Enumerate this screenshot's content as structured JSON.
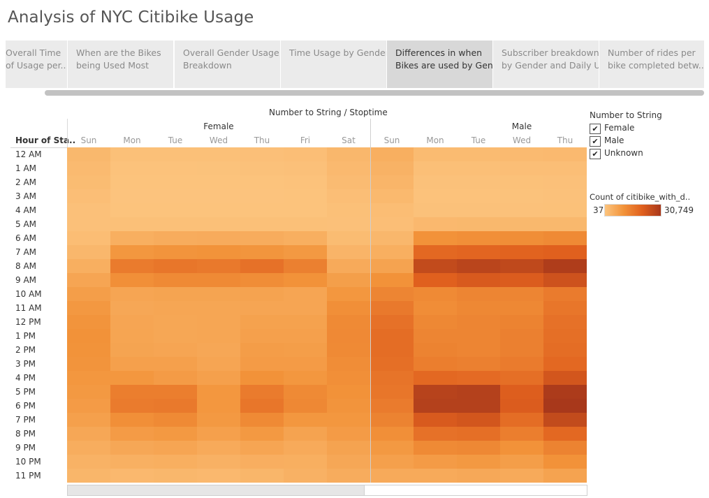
{
  "page_title": "Analysis of NYC Citibike Usage",
  "tabs": [
    {
      "label_line1": "Overall Time",
      "label_line2": "of Usage per..",
      "active": false
    },
    {
      "label_line1": "When are the Bikes",
      "label_line2": "being Used Most",
      "active": false
    },
    {
      "label_line1": "Overall Gender Usage",
      "label_line2": "Breakdown",
      "active": false
    },
    {
      "label_line1": "Time Usage by Gender",
      "label_line2": "",
      "active": false
    },
    {
      "label_line1": "Differences in when",
      "label_line2": "Bikes are used by Gen..",
      "active": true
    },
    {
      "label_line1": "Subscriber breakdown",
      "label_line2": "by Gender and Daily U..",
      "active": false
    },
    {
      "label_line1": "Number of rides per",
      "label_line2": "bike completed betw..",
      "active": false
    }
  ],
  "chart": {
    "column_axis_title": "Number to String / Stoptime",
    "row_header": "Hour of Sta..",
    "groups": [
      "Female",
      "Male"
    ]
  },
  "legend": {
    "filter_title": "Number to String",
    "filters": [
      {
        "label": "Female",
        "checked": true
      },
      {
        "label": "Male",
        "checked": true
      },
      {
        "label": "Unknown",
        "checked": true
      }
    ],
    "color_title": "Count of citibike_with_d..",
    "color_min": "37",
    "color_max": "30,749",
    "check_glyph": "✔"
  },
  "chart_data": {
    "type": "heatmap",
    "title": "",
    "xlabel": "Number to String / Stoptime",
    "ylabel": "Hour of Sta..",
    "value_label": "Count of citibike_with_d..",
    "value_range": [
      37,
      30749
    ],
    "color_scale": [
      "#fcc47e",
      "#f2933a",
      "#e0601e",
      "#a8381b"
    ],
    "hours": [
      "12 AM",
      "1 AM",
      "2 AM",
      "3 AM",
      "4 AM",
      "5 AM",
      "6 AM",
      "7 AM",
      "8 AM",
      "9 AM",
      "10 AM",
      "11 AM",
      "12 PM",
      "1 PM",
      "2 PM",
      "3 PM",
      "4 PM",
      "5 PM",
      "6 PM",
      "7 PM",
      "8 PM",
      "9 PM",
      "10 PM",
      "11 PM"
    ],
    "groups": [
      {
        "name": "Female",
        "days": [
          "Sun",
          "Mon",
          "Tue",
          "Wed",
          "Thu",
          "Fri",
          "Sat"
        ],
        "values": [
          [
            2600,
            900,
            900,
            950,
            1000,
            1300,
            2700
          ],
          [
            2200,
            500,
            500,
            550,
            600,
            800,
            2300
          ],
          [
            1800,
            300,
            300,
            320,
            350,
            500,
            1900
          ],
          [
            1200,
            200,
            200,
            220,
            240,
            300,
            1300
          ],
          [
            800,
            300,
            300,
            320,
            340,
            350,
            900
          ],
          [
            800,
            900,
            900,
            950,
            950,
            900,
            800
          ],
          [
            1500,
            4500,
            5000,
            5200,
            5000,
            4500,
            1800
          ],
          [
            2700,
            9500,
            10000,
            10200,
            9800,
            9000,
            3300
          ],
          [
            4500,
            15000,
            16000,
            15500,
            17000,
            14000,
            5500
          ],
          [
            6500,
            11000,
            12000,
            12000,
            11500,
            10500,
            7800
          ],
          [
            8000,
            6500,
            6800,
            6800,
            7000,
            6500,
            9500
          ],
          [
            9200,
            6000,
            6300,
            6300,
            6500,
            6500,
            11000
          ],
          [
            10000,
            6500,
            6200,
            6300,
            7200,
            7200,
            12000
          ],
          [
            10500,
            6600,
            6200,
            6300,
            7500,
            7500,
            12200
          ],
          [
            10200,
            6800,
            6500,
            6000,
            8200,
            8000,
            12000
          ],
          [
            10000,
            7500,
            7500,
            6500,
            8500,
            8500,
            11500
          ],
          [
            9500,
            9500,
            8500,
            7500,
            10500,
            9500,
            11000
          ],
          [
            9000,
            14500,
            14500,
            9500,
            15000,
            12000,
            10500
          ],
          [
            8500,
            15000,
            15500,
            9500,
            16000,
            12500,
            10000
          ],
          [
            7500,
            11000,
            12000,
            9000,
            12000,
            9500,
            9500
          ],
          [
            6000,
            8500,
            9000,
            7500,
            9000,
            7000,
            8500
          ],
          [
            4800,
            6000,
            6500,
            5500,
            6500,
            5500,
            7000
          ],
          [
            3800,
            4200,
            4500,
            4000,
            4600,
            4500,
            6000
          ],
          [
            3000,
            2500,
            2700,
            2500,
            3000,
            4000,
            5000
          ]
        ]
      },
      {
        "name": "Male",
        "days": [
          "Sun",
          "Mon",
          "Tue",
          "Wed",
          "Thu"
        ],
        "values": [
          [
            4500,
            2000,
            2000,
            2100,
            2300
          ],
          [
            3800,
            1100,
            1100,
            1200,
            1300
          ],
          [
            3200,
            700,
            700,
            750,
            800
          ],
          [
            2400,
            500,
            500,
            550,
            600
          ],
          [
            1500,
            700,
            700,
            700,
            750
          ],
          [
            1300,
            2500,
            2600,
            2600,
            2600
          ],
          [
            2800,
            10500,
            11000,
            11200,
            12000
          ],
          [
            4500,
            19000,
            19500,
            20000,
            20500
          ],
          [
            7000,
            26000,
            27500,
            26500,
            29500
          ],
          [
            10500,
            20500,
            22000,
            21500,
            24000
          ],
          [
            13000,
            12000,
            13000,
            13000,
            15000
          ],
          [
            15500,
            11500,
            12500,
            12500,
            16000
          ],
          [
            17000,
            12500,
            13000,
            13500,
            17000
          ],
          [
            18000,
            13000,
            13000,
            14000,
            17500
          ],
          [
            18000,
            13500,
            13000,
            14000,
            18000
          ],
          [
            17500,
            14500,
            14000,
            15000,
            19000
          ],
          [
            16500,
            19000,
            18500,
            17500,
            23000
          ],
          [
            16000,
            28000,
            28500,
            21000,
            30000
          ],
          [
            15000,
            28500,
            28500,
            21500,
            30749
          ],
          [
            13500,
            22000,
            23000,
            18000,
            26000
          ],
          [
            11000,
            17000,
            17500,
            14500,
            19000
          ],
          [
            9000,
            12000,
            12500,
            10500,
            13500
          ],
          [
            7500,
            8500,
            9000,
            8000,
            10500
          ],
          [
            5500,
            5500,
            5800,
            5500,
            7000
          ]
        ]
      }
    ]
  }
}
